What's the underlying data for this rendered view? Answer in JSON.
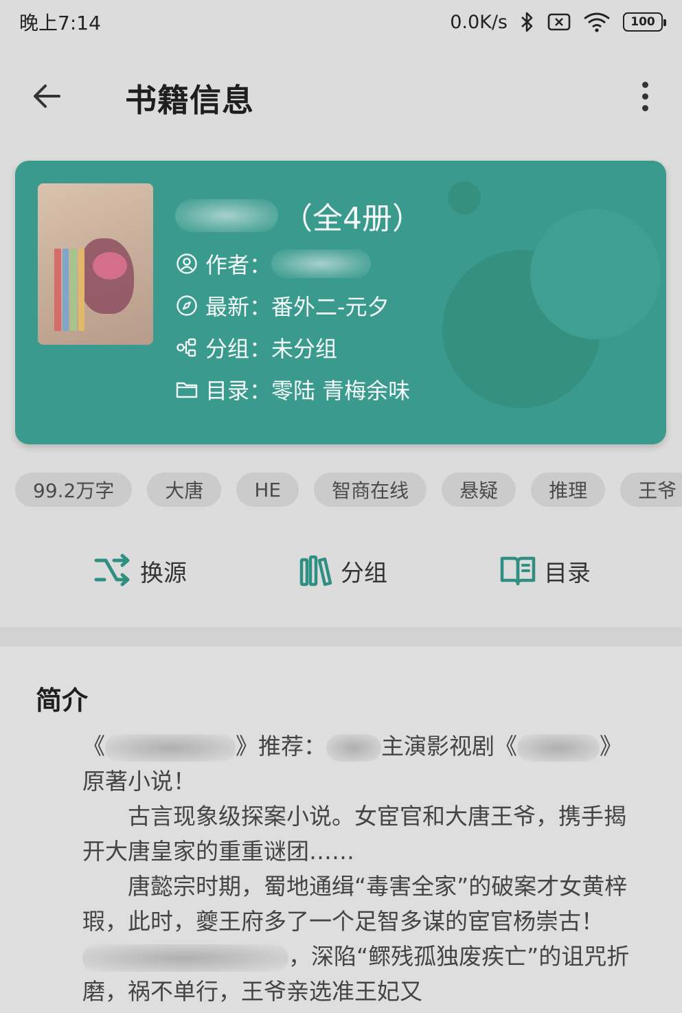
{
  "status_bar": {
    "time": "晚上7:14",
    "network_speed": "0.0K/s",
    "battery": "100",
    "icons": [
      "bluetooth-icon",
      "sim-off-icon",
      "wifi-icon",
      "battery-icon"
    ]
  },
  "toolbar": {
    "title": "书籍信息",
    "back_icon": "arrow-left-icon",
    "more_icon": "more-vertical-icon"
  },
  "book": {
    "title_suffix": "（全4册）",
    "author_label": "作者：",
    "latest_label": "最新：",
    "latest_value": "番外二-元夕",
    "group_label": "分组：",
    "group_value": "未分组",
    "catalog_label": "目录：",
    "catalog_value": "零陆 青梅余味",
    "card_color": "#3a9a8d"
  },
  "tags": [
    "99.2万字",
    "大唐",
    "HE",
    "智商在线",
    "悬疑",
    "推理",
    "王爷"
  ],
  "actions": {
    "change_source": "换源",
    "group": "分组",
    "catalog": "目录",
    "accent_color": "#2f8f81"
  },
  "intro": {
    "title": "简介",
    "line1_a": "《",
    "line1_b": "》推荐：",
    "line1_c": "主演影视剧《",
    "line1_d": "》",
    "line2": "原著小说！",
    "para2": "古言现象级探案小说。女宦官和大唐王爷，携手揭开大唐皇家的重重谜团……",
    "para3_a": "唐懿宗时期，蜀地通缉“毒害全家”的破案才女黄梓瑕，此时，夔王府多了一个足智多谋的宦官杨崇古！",
    "para3_b": "，深陷“鳏残孤独废疾亡”的诅咒折磨，祸不单行，王爷亲选准王妃又"
  }
}
